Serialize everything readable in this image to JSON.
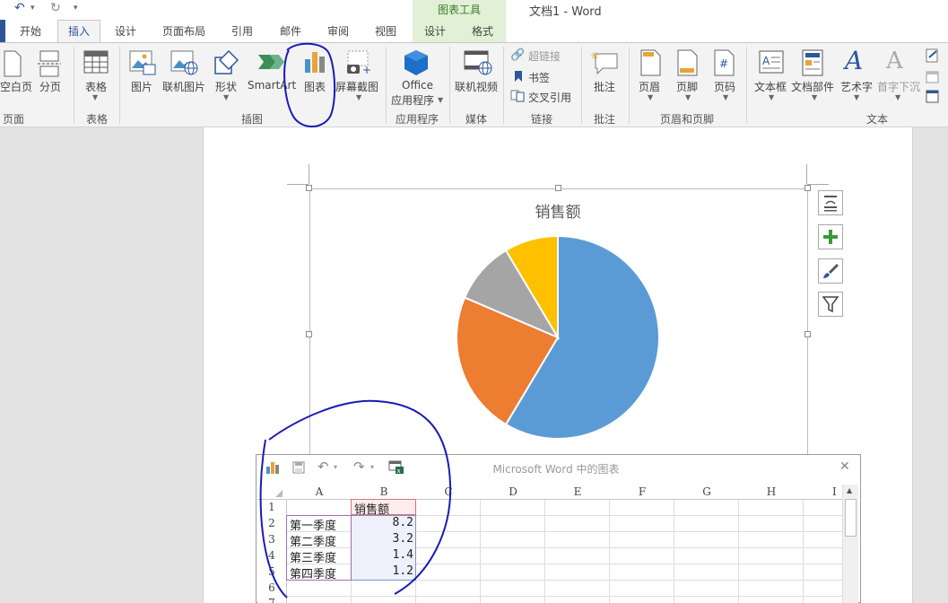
{
  "window": {
    "doc_title": "文档1 - Word",
    "context_title": "图表工具"
  },
  "tabs": {
    "home": "开始",
    "insert": "插入",
    "design": "设计",
    "layout": "页面布局",
    "references": "引用",
    "mailings": "邮件",
    "review": "审阅",
    "view": "视图",
    "chart_design": "设计",
    "chart_format": "格式"
  },
  "ribbon": {
    "blank_page": "空白页",
    "page_break": "分页",
    "table": "表格",
    "picture": "图片",
    "online_picture": "联机图片",
    "shapes": "形状",
    "smartart": "SmartArt",
    "chart": "图表",
    "screenshot": "屏幕截图",
    "office_line1": "Office",
    "office_line2": "应用程序",
    "online_video": "联机视频",
    "hyperlink": "超链接",
    "bookmark": "书签",
    "cross_ref": "交叉引用",
    "comment": "批注",
    "header": "页眉",
    "footer": "页脚",
    "page_number": "页码",
    "textbox": "文本框",
    "quick_parts": "文档部件",
    "wordart": "艺术字",
    "dropcap": "首字下沉",
    "groups": {
      "pages": "页面",
      "tables": "表格",
      "illustrations": "插图",
      "apps": "应用程序",
      "media": "媒体",
      "links": "链接",
      "comments": "批注",
      "header_footer": "页眉和页脚",
      "text": "文本"
    }
  },
  "chart_data": {
    "type": "pie",
    "title": "销售额",
    "categories": [
      "第一季度",
      "第二季度",
      "第三季度",
      "第四季度"
    ],
    "values": [
      8.2,
      3.2,
      1.4,
      1.2
    ],
    "colors": [
      "#5b9bd5",
      "#ed7d31",
      "#a5a5a5",
      "#ffc000"
    ]
  },
  "sheet": {
    "title": "Microsoft Word 中的图表",
    "columns": [
      "A",
      "B",
      "C",
      "D",
      "E",
      "F",
      "G",
      "H",
      "I"
    ],
    "rows": [
      "1",
      "2",
      "3",
      "4",
      "5",
      "6",
      "7"
    ],
    "header_b1": "销售额",
    "a": [
      "第一季度",
      "第二季度",
      "第三季度",
      "第四季度"
    ],
    "b": [
      "8.2",
      "3.2",
      "1.4",
      "1.2"
    ]
  },
  "colors": {
    "brand": "#2b579a",
    "context_tab": "#e2f0d6",
    "annotation": "#1a1ab8"
  }
}
